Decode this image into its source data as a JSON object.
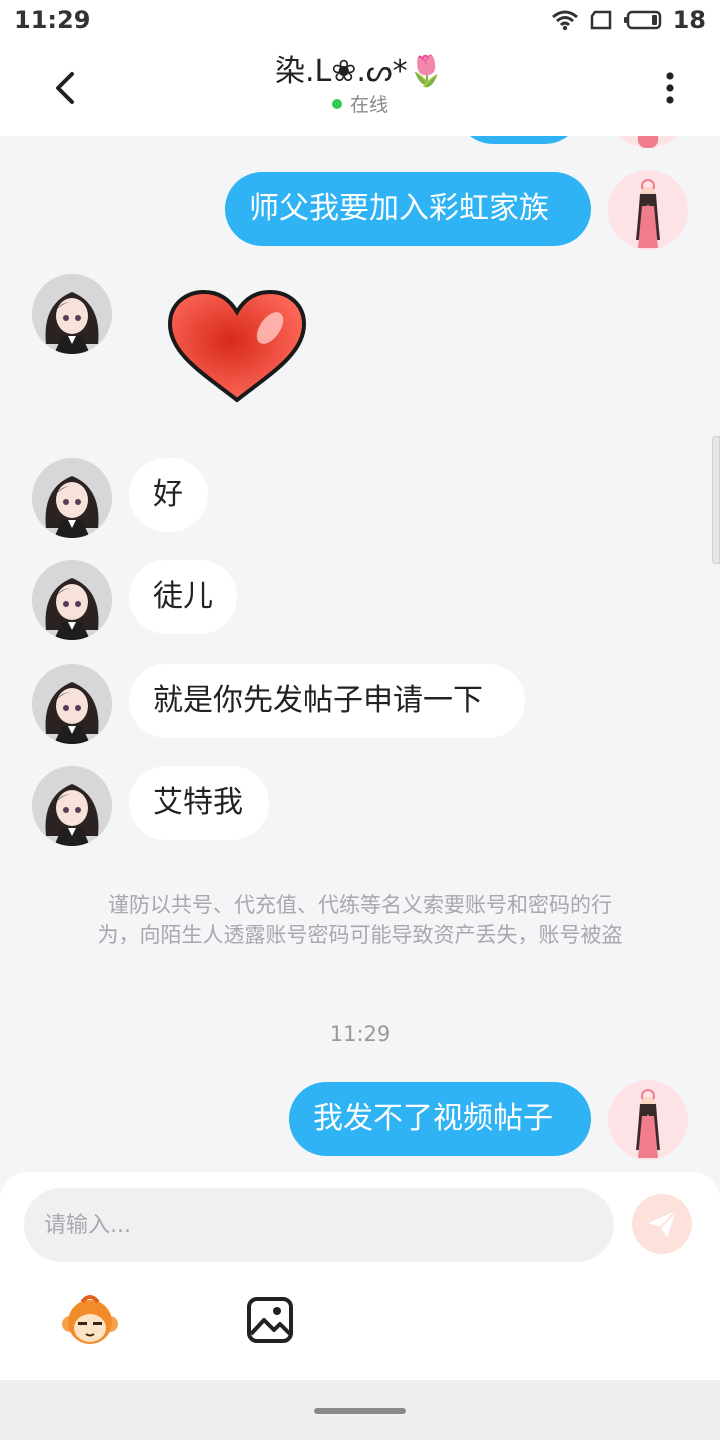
{
  "status_bar": {
    "time": "11:29",
    "battery": "18",
    "icons": [
      "wifi-icon",
      "sim-icon",
      "battery-icon"
    ]
  },
  "header": {
    "title": "染.L❀.ᔕ*🌷",
    "status": "在线",
    "back_icon": "chevron-left-icon",
    "more_icon": "more-vertical-icon"
  },
  "messages": [
    {
      "sender": "me",
      "type": "text",
      "text": "师父我要加入彩虹家族"
    },
    {
      "sender": "other",
      "type": "sticker",
      "sticker": "red-heart"
    },
    {
      "sender": "other",
      "type": "text",
      "text": "好"
    },
    {
      "sender": "other",
      "type": "text",
      "text": "徒儿"
    },
    {
      "sender": "other",
      "type": "text",
      "text": "就是你先发帖子申请一下"
    },
    {
      "sender": "other",
      "type": "text",
      "text": "艾特我"
    },
    {
      "sender": "me",
      "type": "text",
      "text": "我发不了视频帖子"
    }
  ],
  "security_notice": {
    "line1": "谨防以共号、代充值、代练等名义索要账号和密码的行",
    "line2": "为，向陌生人透露账号密码可能导致资产丢失，账号被盗"
  },
  "timestamp": "11:29",
  "composer": {
    "placeholder": "请输入...",
    "send_icon": "paper-plane-icon",
    "tools": [
      "monkey-emoji-icon",
      "image-icon"
    ]
  },
  "colors": {
    "my_bubble": "#2fb3f5",
    "other_bubble": "#ffffff",
    "background": "#f4f5f7",
    "online": "#2ecc52",
    "send_disabled": "#fde2dc"
  }
}
